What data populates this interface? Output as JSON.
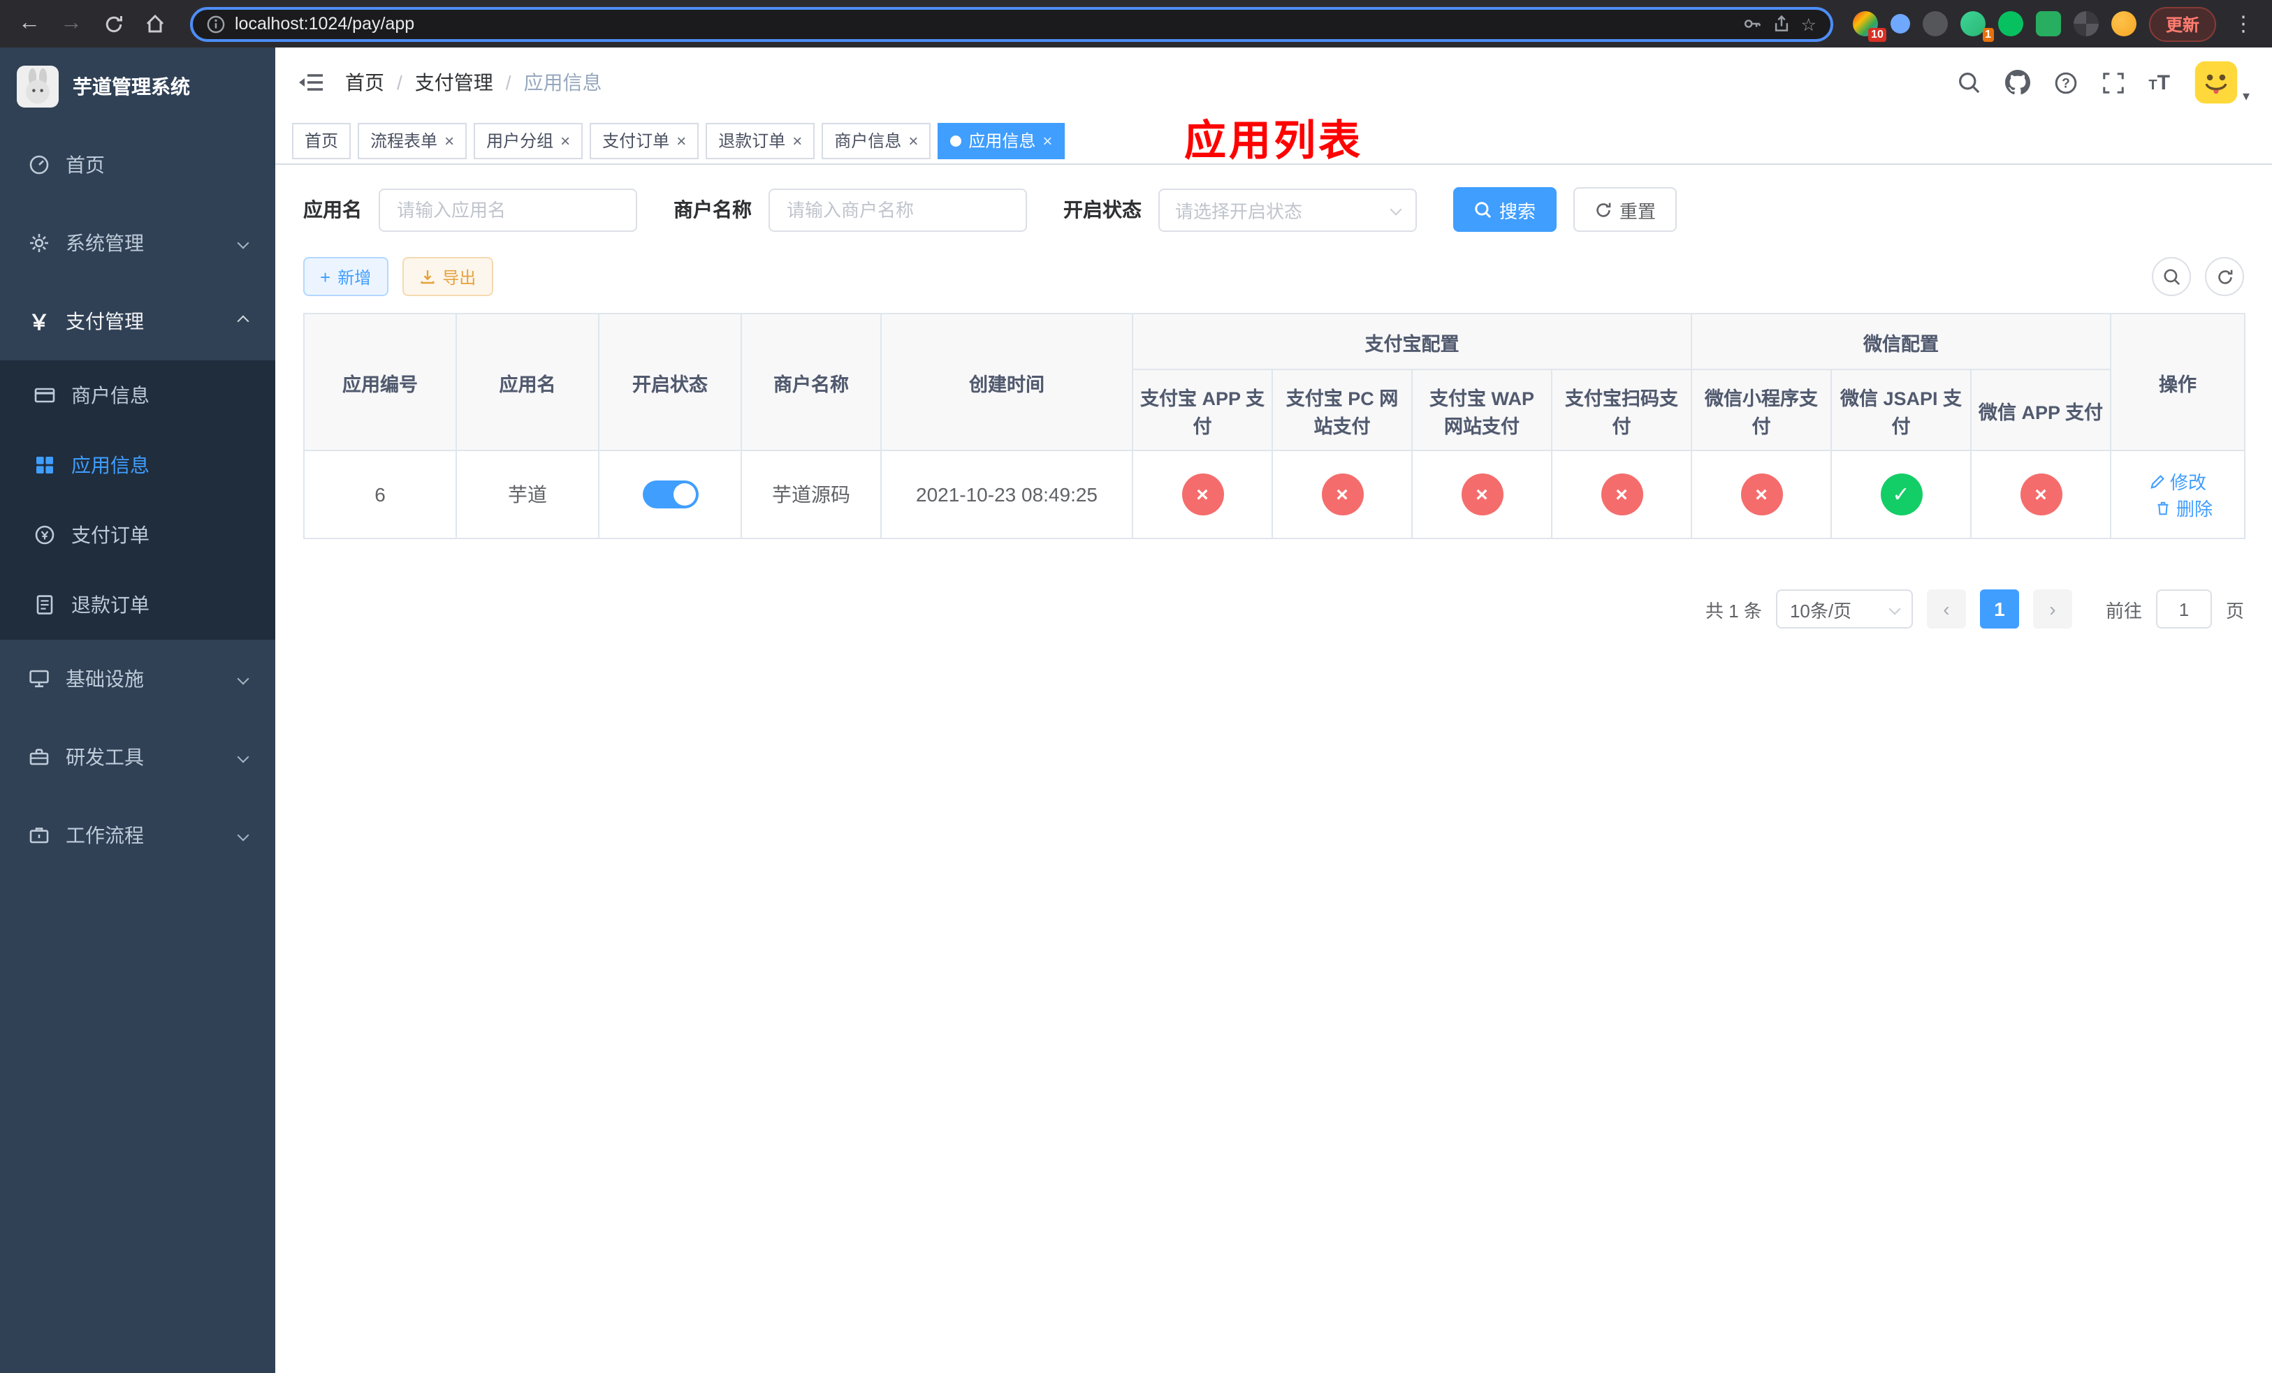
{
  "browser": {
    "url": "localhost:1024/pay/app",
    "update_label": "更新",
    "ext_badge_1": "10",
    "ext_badge_4": "1"
  },
  "sidebar": {
    "title": "芋道管理系统",
    "items": {
      "home": "首页",
      "system": "系统管理",
      "payment": "支付管理",
      "merchant": "商户信息",
      "app": "应用信息",
      "pay_order": "支付订单",
      "refund_order": "退款订单",
      "infra": "基础设施",
      "devtools": "研发工具",
      "workflow": "工作流程"
    }
  },
  "header": {
    "breadcrumb": [
      "首页",
      "支付管理",
      "应用信息"
    ],
    "annotation": "应用列表"
  },
  "tabs": [
    {
      "label": "首页",
      "active": false
    },
    {
      "label": "流程表单",
      "active": false
    },
    {
      "label": "用户分组",
      "active": false
    },
    {
      "label": "支付订单",
      "active": false
    },
    {
      "label": "退款订单",
      "active": false
    },
    {
      "label": "商户信息",
      "active": false
    },
    {
      "label": "应用信息",
      "active": true
    }
  ],
  "filters": {
    "app_name_label": "应用名",
    "app_name_placeholder": "请输入应用名",
    "merchant_label": "商户名称",
    "merchant_placeholder": "请输入商户名称",
    "status_label": "开启状态",
    "status_placeholder": "请选择开启状态",
    "search_label": "搜索",
    "reset_label": "重置"
  },
  "toolbar": {
    "add_label": "新增",
    "export_label": "导出"
  },
  "table": {
    "columns": {
      "id": "应用编号",
      "name": "应用名",
      "status": "开启状态",
      "merchant": "商户名称",
      "created": "创建时间",
      "alipay_group": "支付宝配置",
      "wechat_group": "微信配置",
      "alipay_app": "支付宝 APP 支付",
      "alipay_pc": "支付宝 PC 网站支付",
      "alipay_wap": "支付宝 WAP 网站支付",
      "alipay_qr": "支付宝扫码支付",
      "wx_lite": "微信小程序支付",
      "wx_jsapi": "微信 JSAPI 支付",
      "wx_app": "微信 APP 支付",
      "actions": "操作"
    },
    "actions": {
      "edit": "修改",
      "delete": "删除"
    },
    "rows": [
      {
        "id": "6",
        "name": "芋道",
        "enabled": true,
        "merchant": "芋道源码",
        "created": "2021-10-23 08:49:25",
        "alipay_app": false,
        "alipay_pc": false,
        "alipay_wap": false,
        "alipay_qr": false,
        "wx_lite": false,
        "wx_jsapi": true,
        "wx_app": false
      }
    ]
  },
  "pagination": {
    "total": "共 1 条",
    "page_size": "10条/页",
    "page": "1",
    "goto_label": "前往",
    "goto_value": "1",
    "unit_label": "页"
  }
}
